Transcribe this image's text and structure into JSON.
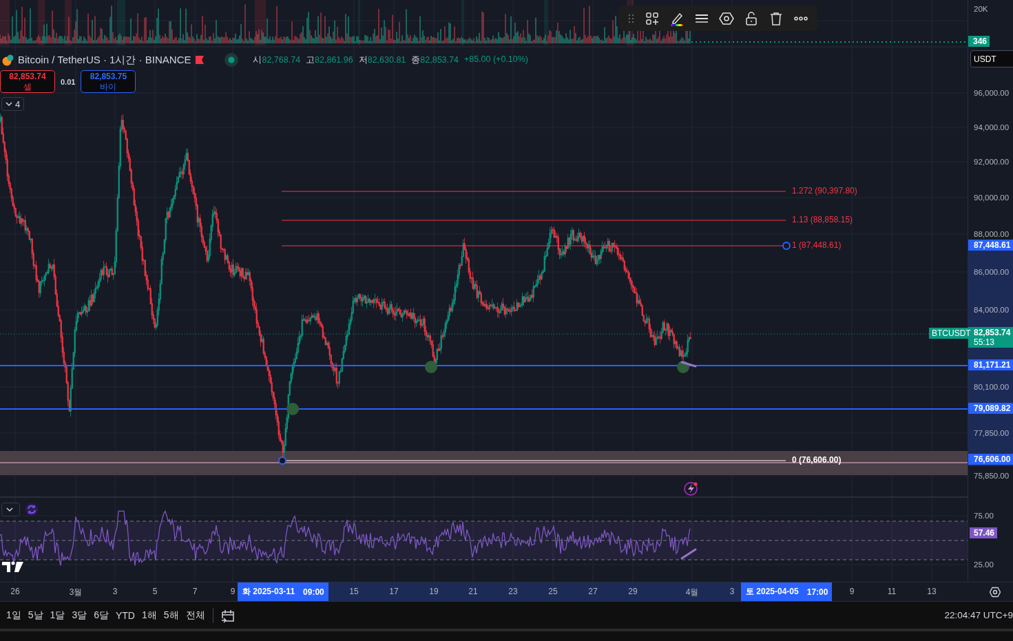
{
  "volume_pane": {
    "axis_label": "20K",
    "last_volume": "346"
  },
  "legend": {
    "symbol": "Bitcoin / TetherUS · 1시간 · BINANCE",
    "ohlc": [
      {
        "label": "시",
        "value": "82,768.74"
      },
      {
        "label": "고",
        "value": "82,861.96"
      },
      {
        "label": "저",
        "value": "82,630.81"
      },
      {
        "label": "종",
        "value": "82,853.74"
      }
    ],
    "change": "+85.00 (+0.10%)"
  },
  "trade": {
    "sell": {
      "price": "82,853.74",
      "label": "셀"
    },
    "spread": "0.01",
    "buy": {
      "price": "82,853.75",
      "label": "바이"
    }
  },
  "indicators_toggle": {
    "count": "4"
  },
  "fib_levels": [
    {
      "label": "1.272 (90,397.80)",
      "color": "#f23645"
    },
    {
      "label": "1.13 (88,858.15)",
      "color": "#f23645"
    },
    {
      "label": "1 (87,448.61)",
      "color": "#f23645"
    },
    {
      "label": "0 (76,606.00)",
      "color": "#ffffff"
    }
  ],
  "price_axis": {
    "currency": "USDT",
    "ticks": [
      "96,000.00",
      "94,000.00",
      "92,000.00",
      "90,000.00",
      "88,000.00",
      "86,000.00",
      "84,000.00",
      "80,100.00",
      "77,850.00",
      "75,850.00"
    ],
    "labels": [
      {
        "kind": "level",
        "value": "87,448.61"
      },
      {
        "kind": "last",
        "value": "82,853.74",
        "countdown": "55:13",
        "symbol": "BTCUSDT"
      },
      {
        "kind": "level",
        "value": "81,171.21"
      },
      {
        "kind": "level",
        "value": "79,089.82"
      },
      {
        "kind": "level",
        "value": "76,606.00"
      }
    ]
  },
  "rsi_pane": {
    "value": "57.46",
    "ticks": [
      "75.00",
      "25.00"
    ]
  },
  "time_axis": {
    "ticks": [
      "26",
      "3월",
      "3",
      "5",
      "7",
      "9",
      "15",
      "17",
      "19",
      "21",
      "23",
      "25",
      "27",
      "29",
      "4월",
      "3",
      "9",
      "11",
      "13"
    ],
    "range_start": {
      "date": "화 2025-03-11",
      "time": "09:00"
    },
    "range_end": {
      "date": "토 2025-04-05",
      "time": "17:00"
    }
  },
  "range_bar": {
    "ranges": [
      "1일",
      "5날",
      "1달",
      "3달",
      "6달",
      "YTD",
      "1해",
      "5해",
      "전체"
    ],
    "clock": "22:04:47 UTC+9"
  }
}
